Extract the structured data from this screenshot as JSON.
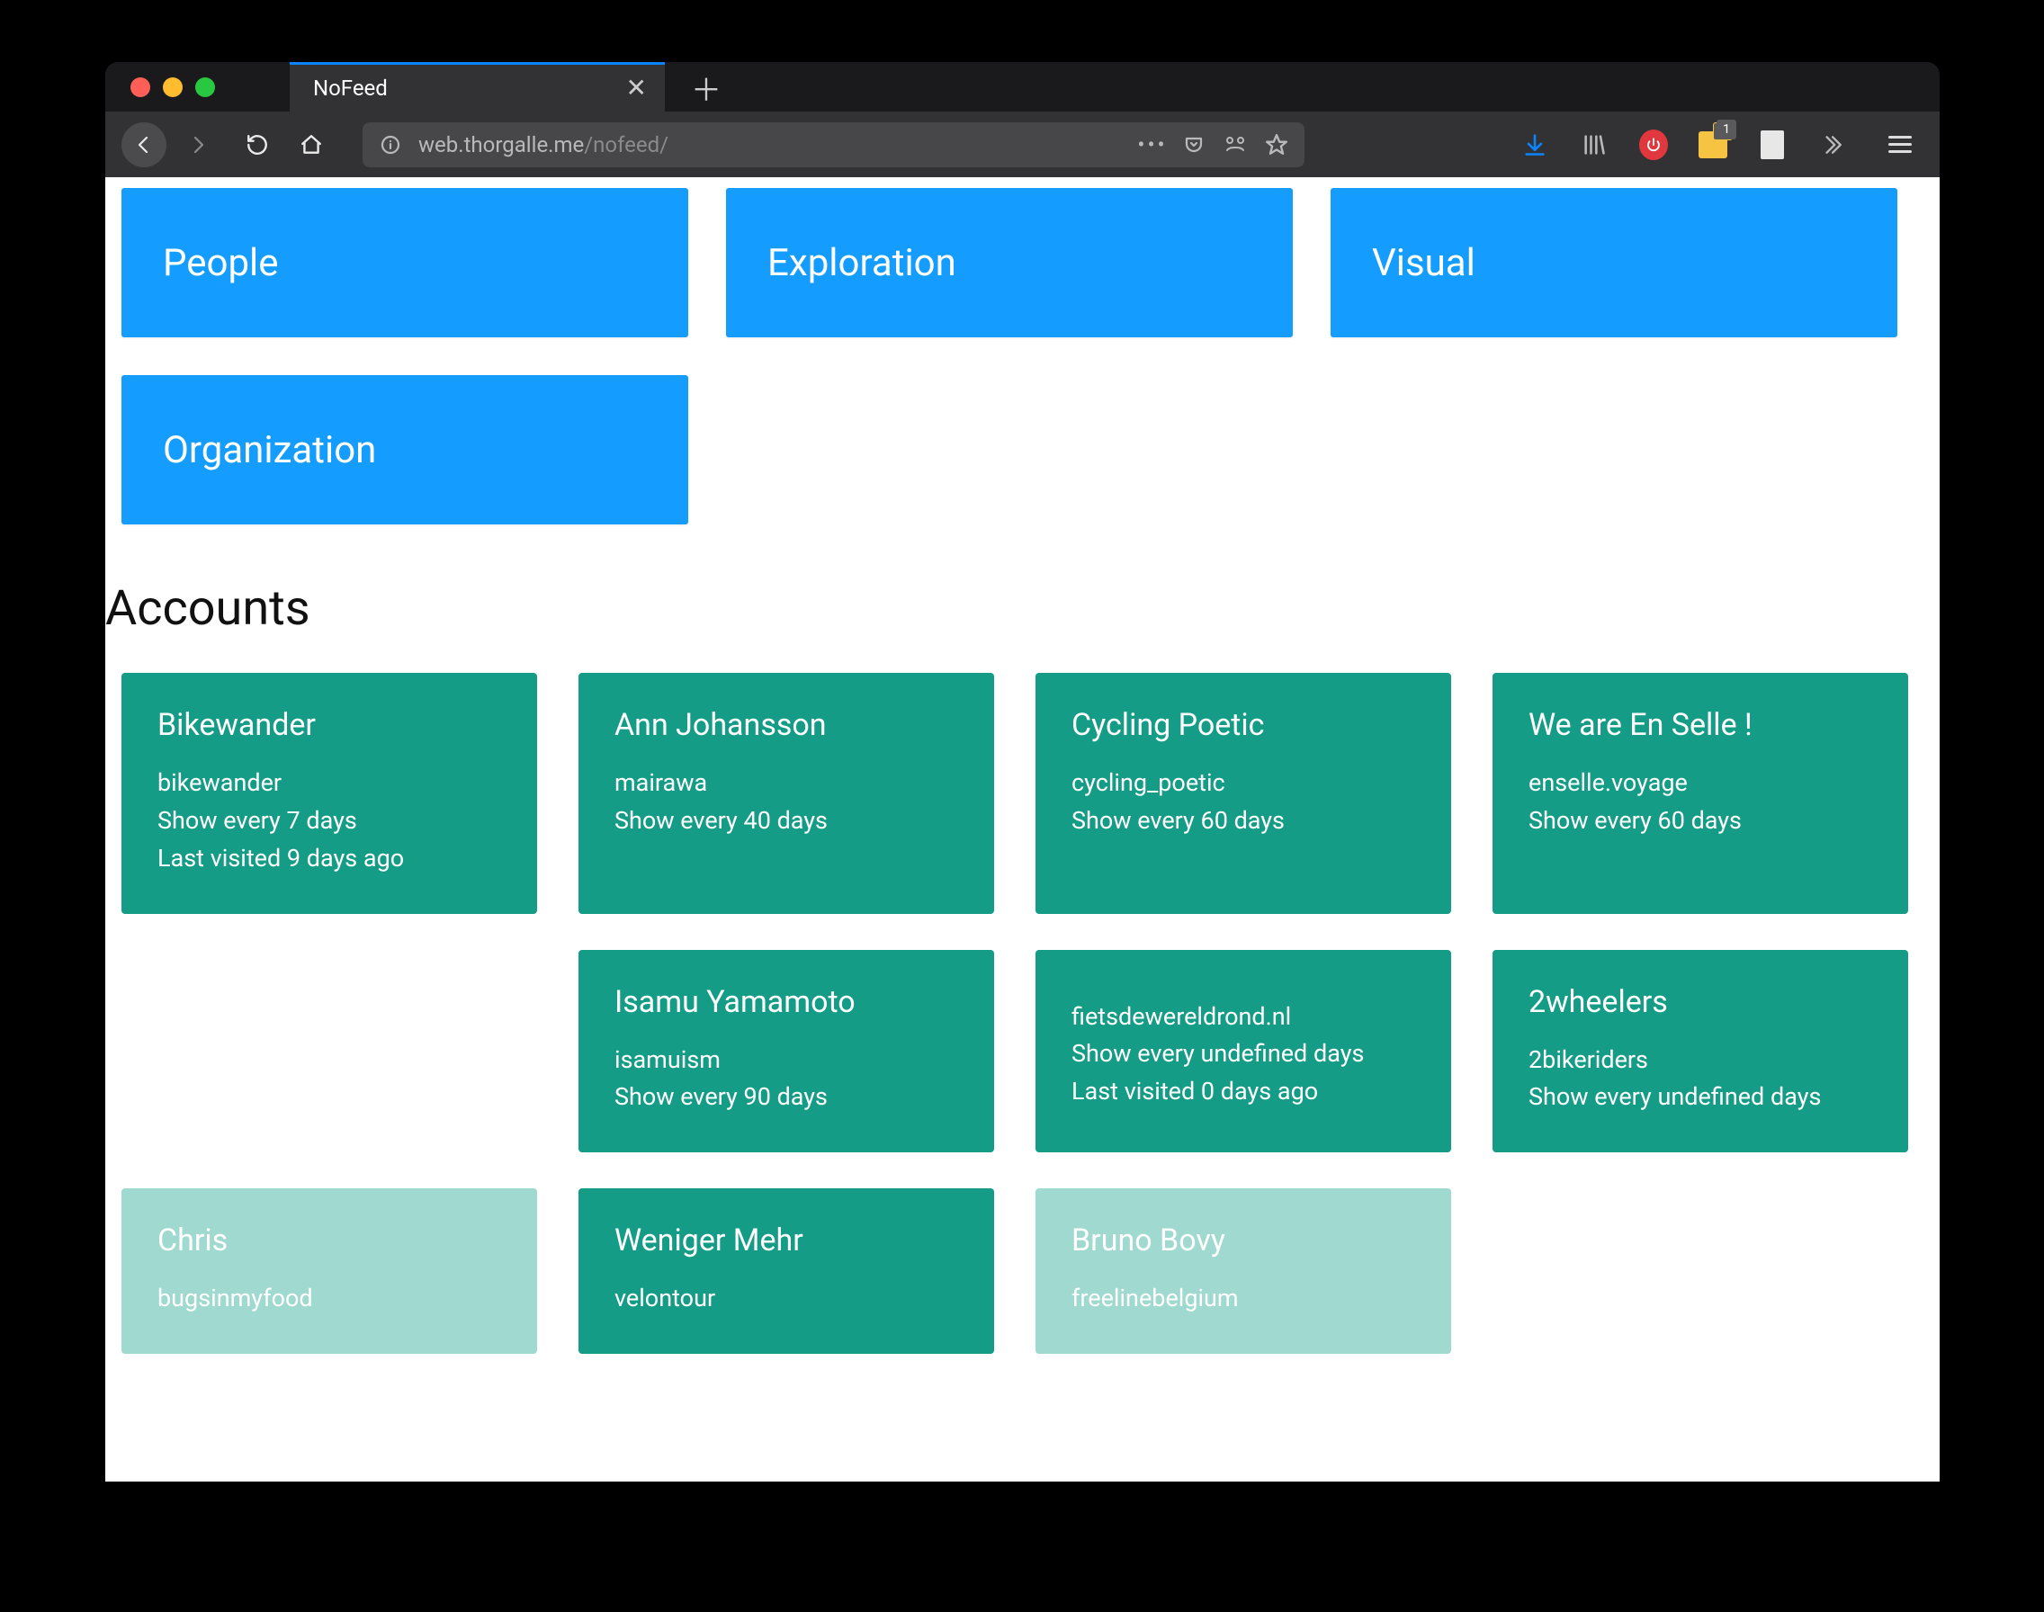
{
  "browser": {
    "tab_title": "NoFeed",
    "url_prefix": "web.thorgalle.me",
    "url_path": "/nofeed/",
    "folder_badge": "1"
  },
  "categories": [
    {
      "label": "People"
    },
    {
      "label": "Exploration"
    },
    {
      "label": "Visual"
    },
    {
      "label": "Organization"
    }
  ],
  "accounts_heading": "Accounts",
  "accounts": [
    {
      "name": "Bikewander",
      "handle": "bikewander",
      "freq": "Show every 7 days",
      "last": "Last visited 9 days ago",
      "faded": false
    },
    {
      "name": "Ann Johansson",
      "handle": "mairawa",
      "freq": "Show every 40 days",
      "last": "",
      "faded": false
    },
    {
      "name": "Cycling Poetic",
      "handle": "cycling_poetic",
      "freq": "Show every 60 days",
      "last": "",
      "faded": false
    },
    {
      "name": "We are En Selle !",
      "handle": "enselle.voyage",
      "freq": "Show every 60 days",
      "last": "",
      "faded": false
    },
    {
      "name": "",
      "handle": "",
      "freq": "",
      "last": "",
      "placeholder": true
    },
    {
      "name": "Isamu Yamamoto",
      "handle": "isamuism",
      "freq": "Show every 90 days",
      "last": "",
      "faded": false
    },
    {
      "name": "",
      "handle": "fietsdewereldrond.nl",
      "freq": "Show every undefined days",
      "last": "Last visited 0 days ago",
      "faded": false,
      "noTitle": true
    },
    {
      "name": "2wheelers",
      "handle": "2bikeriders",
      "freq": "Show every undefined days",
      "last": "",
      "faded": false
    },
    {
      "name": "Chris",
      "handle": "bugsinmyfood",
      "freq": "",
      "last": "",
      "faded": true
    },
    {
      "name": "Weniger Mehr",
      "handle": "velontour",
      "freq": "",
      "last": "",
      "faded": false
    },
    {
      "name": "Bruno Bovy",
      "handle": "freelinebelgium",
      "freq": "",
      "last": "",
      "faded": true
    }
  ]
}
